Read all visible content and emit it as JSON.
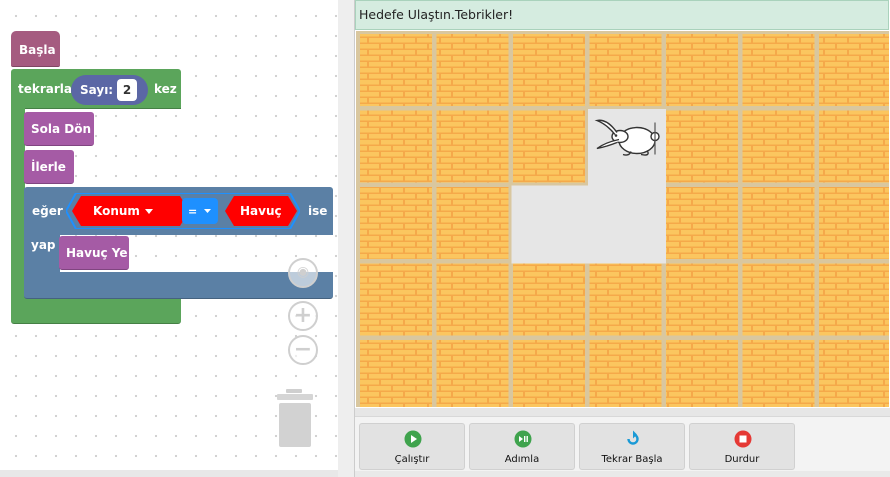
{
  "workspace": {
    "start_block": "Başla",
    "repeat_block": {
      "prefix": "tekrarla",
      "count_label": "Sayı:",
      "count_value": "2",
      "suffix": "kez"
    },
    "statements": [
      "Sola Dön",
      "İlerle"
    ],
    "if_block": {
      "prefix": "eğer",
      "left_operand": "Konum",
      "operator": "=",
      "right_operand": "Havuç",
      "suffix": "ise",
      "do_label": "yap",
      "action": "Havuç Ye"
    },
    "controls": [
      "recenter-icon",
      "zoom-in-icon",
      "zoom-out-icon",
      "trash-icon"
    ]
  },
  "game": {
    "status_message": "Hedefe Ulaştın.Tebrikler!",
    "grid": {
      "rows": 5,
      "cols": 7
    },
    "open_cells": [
      [
        1,
        3
      ],
      [
        2,
        2
      ],
      [
        2,
        3
      ]
    ],
    "rabbit_cell": [
      1,
      3
    ]
  },
  "toolbar": {
    "buttons": [
      {
        "label": "Çalıştır",
        "icon": "play-icon",
        "color": "#3fa34d"
      },
      {
        "label": "Adımla",
        "icon": "step-icon",
        "color": "#3fa34d"
      },
      {
        "label": "Tekrar Başla",
        "icon": "restart-icon",
        "color": "#1a9ad6"
      },
      {
        "label": "Durdur",
        "icon": "stop-icon",
        "color": "#e53935"
      }
    ]
  },
  "colors": {
    "event": "#a55b80",
    "loop": "#5ba55b",
    "action": "#a55ba5",
    "logic": "#5b80a5",
    "math": "#5b67a5",
    "dropdown_red": "#ff0000",
    "status_bg": "#d5ece0"
  }
}
